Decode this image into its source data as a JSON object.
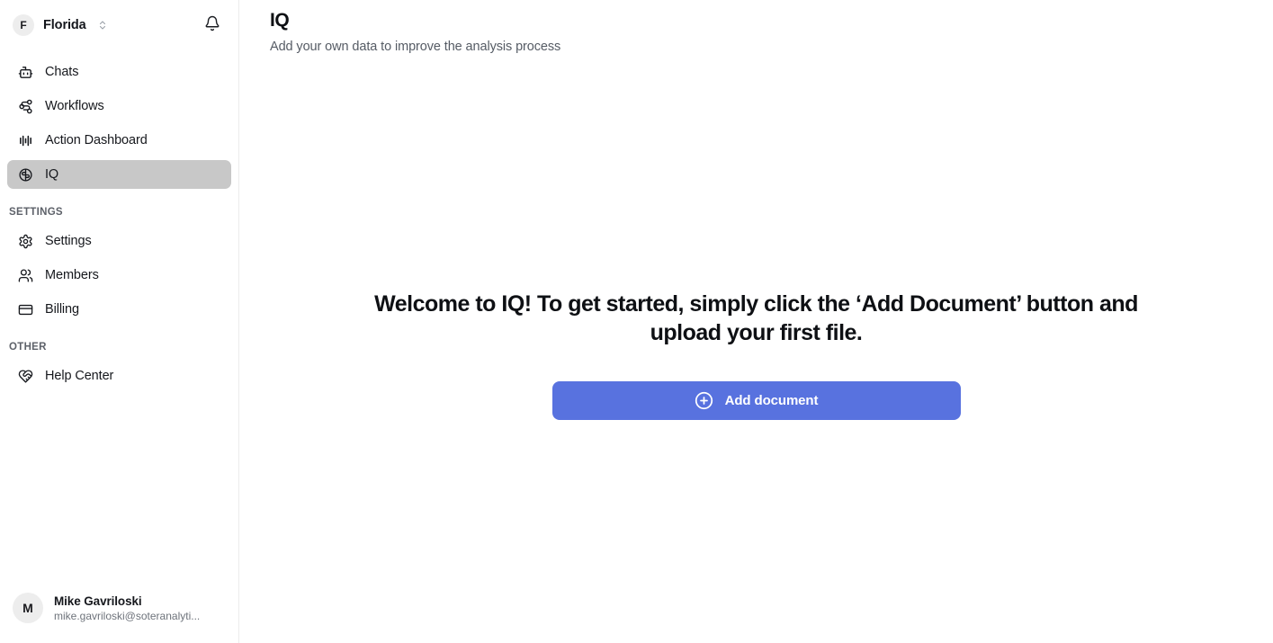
{
  "sidebar": {
    "org": {
      "avatar_initial": "F",
      "name": "Florida",
      "selector_icon": "chevron-up-down-icon",
      "notification_icon": "bell-icon"
    },
    "nav_items": [
      {
        "label": "Chats",
        "icon": "bot-icon",
        "active": false
      },
      {
        "label": "Workflows",
        "icon": "workflow-icon",
        "active": false
      },
      {
        "label": "Action Dashboard",
        "icon": "audio-lines-icon",
        "active": false
      },
      {
        "label": "IQ",
        "icon": "brain-icon",
        "active": true
      }
    ],
    "settings_section": {
      "label": "SETTINGS",
      "items": [
        {
          "label": "Settings",
          "icon": "gear-icon"
        },
        {
          "label": "Members",
          "icon": "users-icon"
        },
        {
          "label": "Billing",
          "icon": "credit-card-icon"
        }
      ]
    },
    "other_section": {
      "label": "OTHER",
      "items": [
        {
          "label": "Help Center",
          "icon": "heart-handshake-icon"
        }
      ]
    },
    "user": {
      "avatar_initial": "M",
      "name": "Mike Gavriloski",
      "email": "mike.gavriloski@soteranalyti..."
    }
  },
  "main": {
    "title": "IQ",
    "subtitle": "Add your own data to improve the analysis process",
    "empty_state": {
      "message": "Welcome to IQ! To get started, simply click the ‘Add Document’ button and upload your first file.",
      "button_label": "Add document",
      "button_icon": "circle-plus-icon"
    }
  },
  "colors": {
    "accent": "#5872df",
    "active_nav_bg": "#c8c8c8",
    "text_primary": "#0e1014",
    "text_muted": "#565c65",
    "border": "#ececec"
  }
}
